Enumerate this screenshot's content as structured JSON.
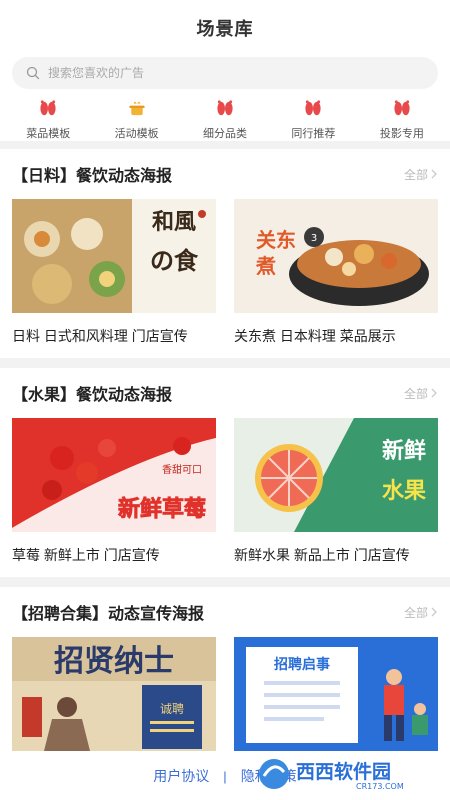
{
  "header": {
    "title": "场景库"
  },
  "search": {
    "placeholder": "搜索您喜欢的广告"
  },
  "categories": [
    {
      "label": "菜品模板",
      "icon": "feet-icon"
    },
    {
      "label": "活动模板",
      "icon": "pot-icon"
    },
    {
      "label": "细分品类",
      "icon": "feet-icon"
    },
    {
      "label": "同行推荐",
      "icon": "feet-icon"
    },
    {
      "label": "投影专用",
      "icon": "feet-icon"
    }
  ],
  "sections": [
    {
      "title": "【日料】餐饮动态海报",
      "all_label": "全部",
      "cards": [
        {
          "caption": "日料 日式和风料理 门店宣传",
          "poster_text": "和風の食"
        },
        {
          "caption": "关东煮 日本料理 菜品展示",
          "poster_text": "关东煮"
        }
      ]
    },
    {
      "title": "【水果】餐饮动态海报",
      "all_label": "全部",
      "cards": [
        {
          "caption": "草莓 新鲜上市 门店宣传",
          "poster_text": "新鲜草莓",
          "poster_sub": "香甜可口"
        },
        {
          "caption": "新鲜水果 新品上市 门店宣传",
          "poster_text": "新鲜水果"
        }
      ]
    },
    {
      "title": "【招聘合集】动态宣传海报",
      "all_label": "全部",
      "cards": [
        {
          "caption": "",
          "poster_text": "招贤纳士",
          "poster_sub": "诚聘"
        },
        {
          "caption": "",
          "poster_text": "招聘启事"
        }
      ]
    }
  ],
  "footer": {
    "user_agreement": "用户协议",
    "separator": "|",
    "privacy": "隐私政策"
  },
  "watermark": {
    "text": "西西软件园",
    "sub": "CR173.COM"
  },
  "colors": {
    "accent_red": "#e8494a",
    "link_blue": "#3b6fd6",
    "divider_gray": "#f2f2f2"
  }
}
